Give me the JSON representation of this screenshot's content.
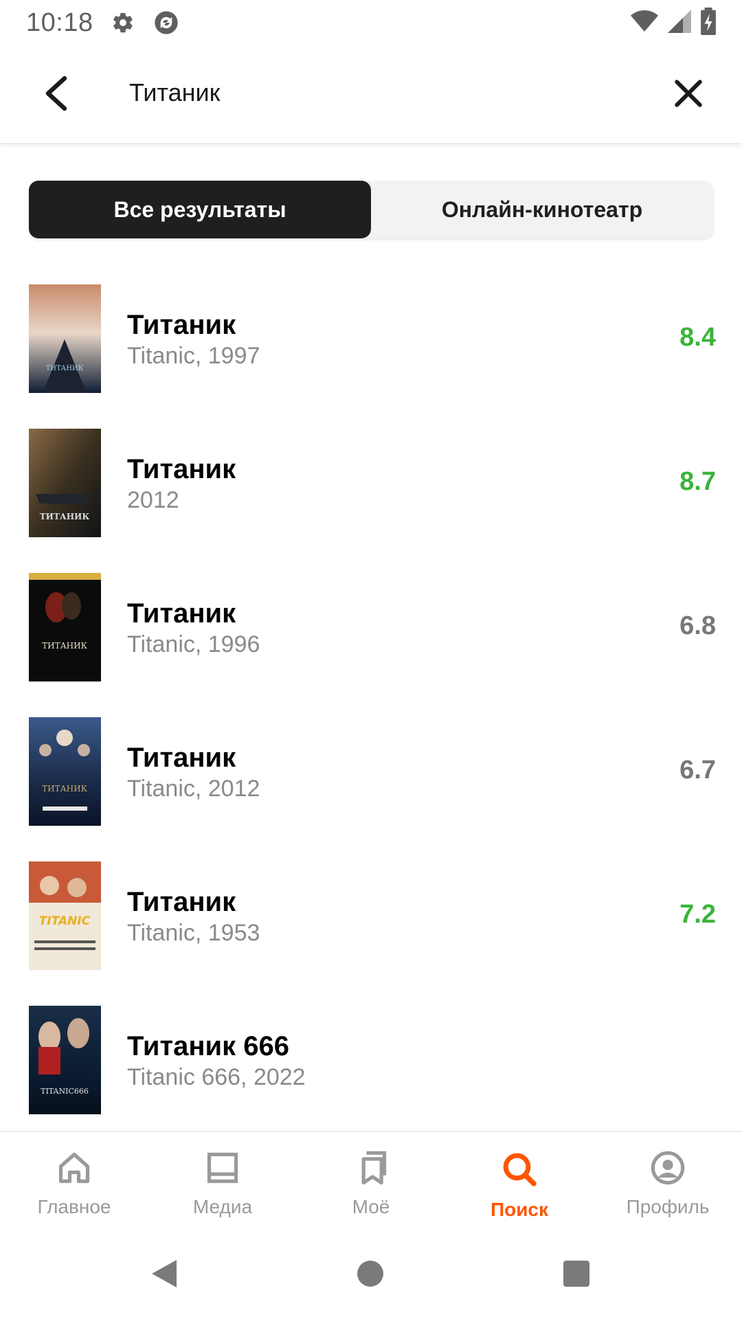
{
  "status_bar": {
    "time": "10:18",
    "icons": [
      "gear-icon",
      "sync-icon",
      "wifi-icon",
      "signal-icon",
      "battery-icon"
    ]
  },
  "header": {
    "query": "Титаник",
    "back_icon": "arrow-left-icon",
    "clear_icon": "close-icon"
  },
  "tabs": [
    {
      "label": "Все результаты",
      "active": true
    },
    {
      "label": "Онлайн-кинотеатр",
      "active": false
    }
  ],
  "results": [
    {
      "title": "Титаник",
      "subtitle": "Titanic, 1997",
      "rating": "8.4",
      "rating_color": "#3bb33b",
      "poster_text": "ТИТАНИК"
    },
    {
      "title": "Титаник",
      "subtitle": "2012",
      "rating": "8.7",
      "rating_color": "#3bb33b",
      "poster_text": "ТИТАНИК"
    },
    {
      "title": "Титаник",
      "subtitle": "Titanic, 1996",
      "rating": "6.8",
      "rating_color": "#777777",
      "poster_text": "ТИТАНИК"
    },
    {
      "title": "Титаник",
      "subtitle": "Titanic, 2012",
      "rating": "6.7",
      "rating_color": "#777777",
      "poster_text": "ТИТАНИК"
    },
    {
      "title": "Титаник",
      "subtitle": "Titanic, 1953",
      "rating": "7.2",
      "rating_color": "#3bb33b",
      "poster_text": "TITANIC"
    },
    {
      "title": "Титаник 666",
      "subtitle": "Titanic 666, 2022",
      "rating": "",
      "rating_color": "",
      "poster_text": "TITANIC666"
    }
  ],
  "bottom_nav": [
    {
      "label": "Главное",
      "icon": "home-icon",
      "active": false
    },
    {
      "label": "Медиа",
      "icon": "media-icon",
      "active": false
    },
    {
      "label": "Моё",
      "icon": "bookmarks-icon",
      "active": false
    },
    {
      "label": "Поиск",
      "icon": "search-icon",
      "active": true
    },
    {
      "label": "Профиль",
      "icon": "profile-icon",
      "active": false
    }
  ],
  "colors": {
    "accent": "#ff5500",
    "rating_good": "#3bb33b",
    "rating_mid": "#777777",
    "tab_active_bg": "#1f1f1f"
  }
}
